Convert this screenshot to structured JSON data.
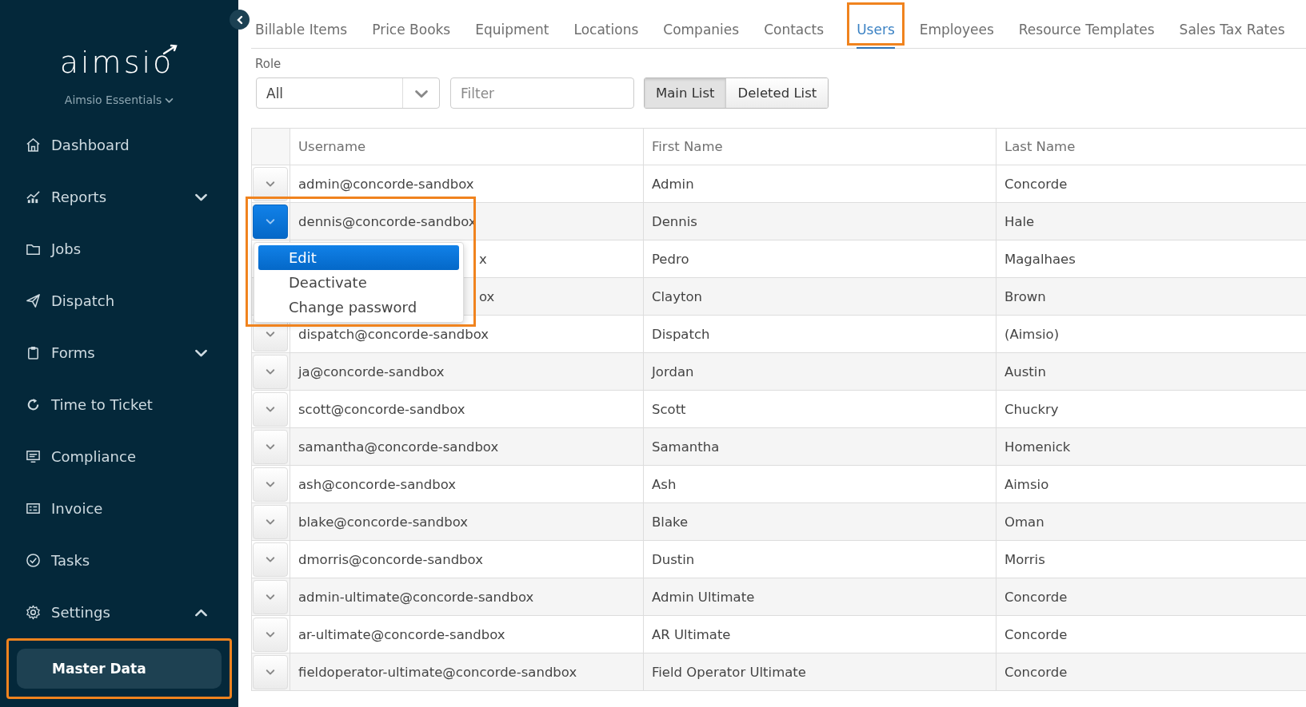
{
  "sidebar": {
    "logo": "aimsio",
    "workspace": "Aimsio Essentials",
    "items": [
      {
        "label": "Dashboard"
      },
      {
        "label": "Reports",
        "expanded": false
      },
      {
        "label": "Jobs"
      },
      {
        "label": "Dispatch"
      },
      {
        "label": "Forms",
        "expanded": false
      },
      {
        "label": "Time to Ticket"
      },
      {
        "label": "Compliance"
      },
      {
        "label": "Invoice"
      },
      {
        "label": "Tasks"
      },
      {
        "label": "Settings",
        "expanded": true,
        "children": [
          {
            "label": "Master Data",
            "selected": true,
            "highlighted": true
          }
        ]
      }
    ]
  },
  "tabs": [
    {
      "label": "Billable Items",
      "selected": false,
      "highlighted": false
    },
    {
      "label": "Price Books",
      "selected": false,
      "highlighted": false
    },
    {
      "label": "Equipment",
      "selected": false,
      "highlighted": false
    },
    {
      "label": "Locations",
      "selected": false,
      "highlighted": false
    },
    {
      "label": "Companies",
      "selected": false,
      "highlighted": false
    },
    {
      "label": "Contacts",
      "selected": false,
      "highlighted": false
    },
    {
      "label": "Users",
      "selected": true,
      "highlighted": true
    },
    {
      "label": "Employees",
      "selected": false,
      "highlighted": false
    },
    {
      "label": "Resource Templates",
      "selected": false,
      "highlighted": false
    },
    {
      "label": "Sales Tax Rates",
      "selected": false,
      "highlighted": false
    }
  ],
  "filters": {
    "role_label": "Role",
    "role_value": "All",
    "filter_placeholder": "Filter"
  },
  "view_toggle": [
    {
      "label": "Main List",
      "selected": true
    },
    {
      "label": "Deleted List",
      "selected": false
    }
  ],
  "table": {
    "columns": [
      "Username",
      "First Name",
      "Last Name"
    ],
    "rows": [
      {
        "username": "admin@concorde-sandbox",
        "first_name": "Admin",
        "last_name": "Concorde",
        "selected": false,
        "highlighted": false
      },
      {
        "username": "dennis@concorde-sandbox",
        "first_name": "Dennis",
        "last_name": "Hale",
        "selected": true,
        "highlighted": true,
        "menu": [
          {
            "label": "Edit",
            "selected": true
          },
          {
            "label": "Deactivate",
            "selected": false
          },
          {
            "label": "Change password",
            "selected": false
          }
        ]
      },
      {
        "username": "x",
        "first_name": "Pedro",
        "last_name": "Magalhaes",
        "highlighted": false,
        "covered": true
      },
      {
        "username": "ox",
        "first_name": "Clayton",
        "last_name": "Brown",
        "highlighted": false,
        "covered": true
      },
      {
        "username": "dispatch@concorde-sandbox",
        "first_name": "Dispatch",
        "last_name": "(Aimsio)",
        "selected": false,
        "highlighted": false
      },
      {
        "username": "ja@concorde-sandbox",
        "first_name": "Jordan",
        "last_name": "Austin",
        "selected": false,
        "highlighted": false
      },
      {
        "username": "scott@concorde-sandbox",
        "first_name": "Scott",
        "last_name": "Chuckry",
        "selected": false,
        "highlighted": false
      },
      {
        "username": "samantha@concorde-sandbox",
        "first_name": "Samantha",
        "last_name": "Homenick",
        "selected": false,
        "highlighted": false
      },
      {
        "username": "ash@concorde-sandbox",
        "first_name": "Ash",
        "last_name": "Aimsio",
        "selected": false,
        "highlighted": false
      },
      {
        "username": "blake@concorde-sandbox",
        "first_name": "Blake",
        "last_name": "Oman",
        "selected": false,
        "highlighted": false
      },
      {
        "username": "dmorris@concorde-sandbox",
        "first_name": "Dustin",
        "last_name": "Morris",
        "selected": false,
        "highlighted": false
      },
      {
        "username": "admin-ultimate@concorde-sandbox",
        "first_name": "Admin Ultimate",
        "last_name": "Concorde",
        "selected": false,
        "highlighted": false
      },
      {
        "username": "ar-ultimate@concorde-sandbox",
        "first_name": "AR Ultimate",
        "last_name": "Concorde",
        "selected": false,
        "highlighted": false
      },
      {
        "username": "fieldoperator-ultimate@concorde-sandbox",
        "first_name": "Field Operator Ultimate",
        "last_name": "Concorde",
        "selected": false,
        "highlighted": false
      }
    ]
  }
}
